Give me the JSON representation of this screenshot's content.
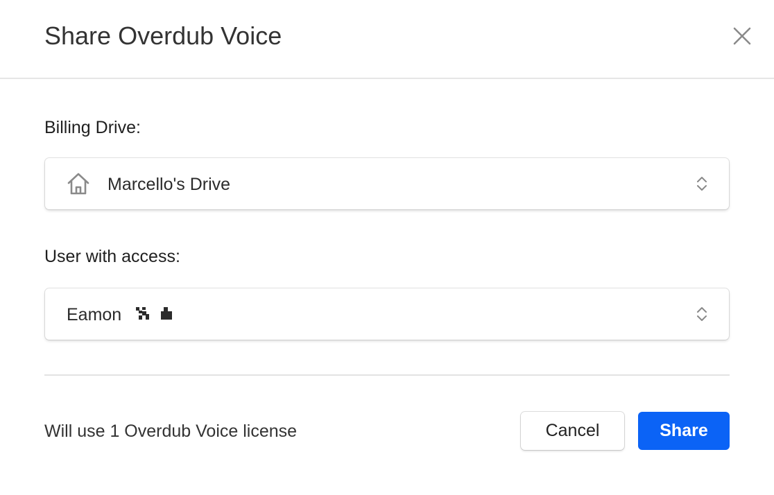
{
  "dialog": {
    "title": "Share Overdub Voice",
    "close_icon": "close-icon"
  },
  "billing": {
    "label": "Billing Drive:",
    "selected": "Marcello's Drive",
    "icon": "house-icon"
  },
  "user_access": {
    "label": "User with access:",
    "selected": "Eamon"
  },
  "footer": {
    "note": "Will use 1 Overdub Voice license",
    "cancel_label": "Cancel",
    "share_label": "Share"
  },
  "colors": {
    "accent": "#0b63f6",
    "divider": "#e2e2e2",
    "text": "#2b2b2b"
  }
}
